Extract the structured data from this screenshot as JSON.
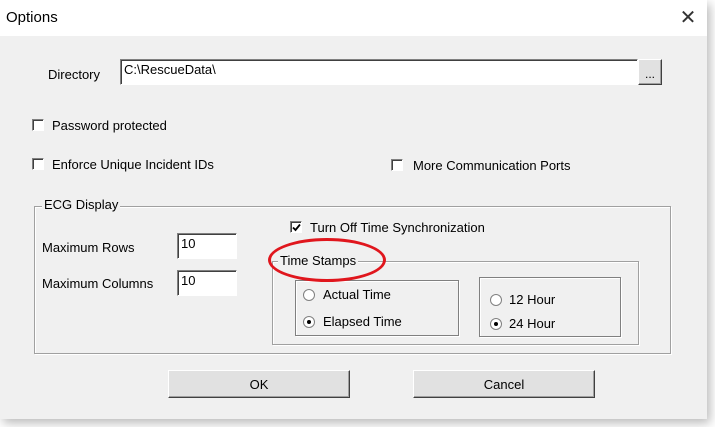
{
  "window": {
    "title": "Options",
    "close_glyph": "✕"
  },
  "directory": {
    "label": "Directory",
    "value": "C:\\RescueData\\",
    "browse_label": "..."
  },
  "checkboxes": {
    "password_protected": {
      "label": "Password protected",
      "checked": false
    },
    "enforce_unique_ids": {
      "label": "Enforce Unique Incident IDs",
      "checked": false
    },
    "more_comm_ports": {
      "label": "More Communication Ports",
      "checked": false
    }
  },
  "ecg_display": {
    "group_label": "ECG Display",
    "max_rows_label": "Maximum Rows",
    "max_rows_value": "10",
    "max_columns_label": "Maximum Columns",
    "max_columns_value": "10",
    "turn_off_sync": {
      "label": "Turn Off Time Synchronization",
      "checked": true
    },
    "time_stamps": {
      "group_label": "Time Stamps",
      "actual_time": {
        "label": "Actual Time",
        "selected": false
      },
      "elapsed_time": {
        "label": "Elapsed Time",
        "selected": true
      },
      "hour_12": {
        "label": "12 Hour",
        "selected": false
      },
      "hour_24": {
        "label": "24 Hour",
        "selected": true
      }
    }
  },
  "buttons": {
    "ok_label": "OK",
    "cancel_label": "Cancel"
  },
  "colors": {
    "annotation": "#e0161d",
    "dialog_bg": "#f0f0f0"
  }
}
